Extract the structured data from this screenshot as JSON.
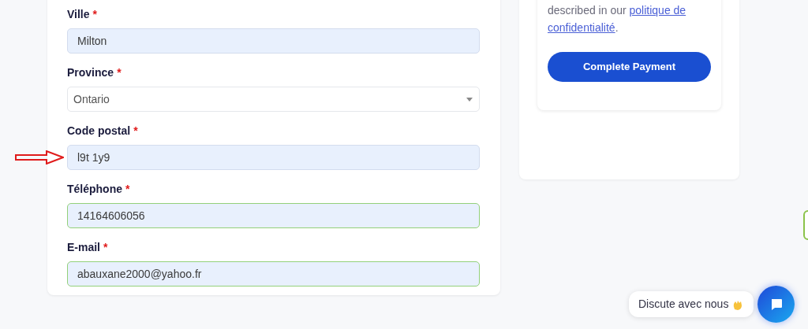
{
  "form": {
    "fields": [
      {
        "label": "Ville",
        "required_mark": "*",
        "kind": "input",
        "value": "Milton",
        "valid": false
      },
      {
        "label": "Province",
        "required_mark": "*",
        "kind": "select",
        "value": "Ontario",
        "valid": false
      },
      {
        "label": "Code postal",
        "required_mark": "*",
        "kind": "input",
        "value": "l9t 1y9",
        "valid": false,
        "annotated": true
      },
      {
        "label": "Téléphone",
        "required_mark": "*",
        "kind": "input",
        "value": "14164606056",
        "valid": true
      },
      {
        "label": "E-mail",
        "required_mark": "*",
        "kind": "input",
        "value": "abauxane2000@yahoo.fr",
        "valid": true
      }
    ]
  },
  "summary": {
    "notice": "described in our",
    "privacy_link_lines": [
      "politique de",
      "confidentialité"
    ],
    "notice_end": ".",
    "pay_button": "Complete Payment"
  },
  "chat": {
    "prompt": "Discute avec nous"
  }
}
